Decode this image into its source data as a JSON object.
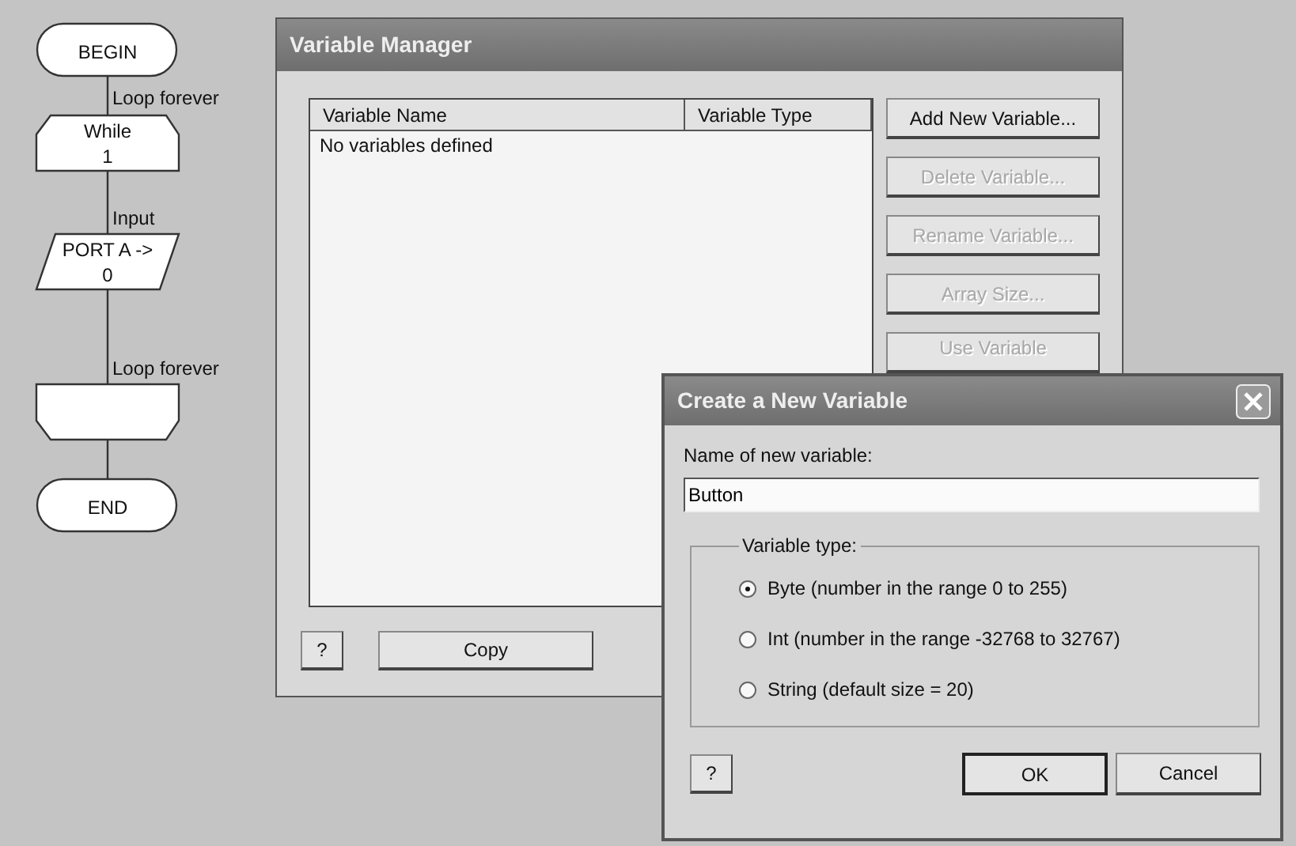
{
  "flowchart": {
    "nodes": [
      {
        "kind": "terminal",
        "text": [
          "BEGIN"
        ]
      },
      {
        "kind": "loop_start",
        "label": "Loop forever",
        "text": [
          "While",
          "1"
        ]
      },
      {
        "kind": "input",
        "label": "Input",
        "text": [
          "PORT A ->",
          "0"
        ]
      },
      {
        "kind": "loop_end",
        "label": "Loop forever"
      },
      {
        "kind": "terminal",
        "text": [
          "END"
        ]
      }
    ]
  },
  "variable_manager": {
    "title": "Variable Manager",
    "columns": [
      "Variable Name",
      "Variable Type"
    ],
    "empty_message": "No variables defined",
    "side_buttons": [
      {
        "label": "Add New Variable...",
        "disabled": false
      },
      {
        "label": "Delete Variable...",
        "disabled": true
      },
      {
        "label": "Rename Variable...",
        "disabled": true
      },
      {
        "label": "Array Size...",
        "disabled": true
      },
      {
        "label": "Use Variable",
        "disabled": true
      }
    ],
    "bottom_buttons": [
      {
        "kind": "help",
        "label": "?"
      },
      {
        "kind": "action",
        "label": "Copy"
      }
    ]
  },
  "create_dialog": {
    "title": "Create a New Variable",
    "name_label": "Name of new variable:",
    "name_value": "Button",
    "type_group": "Variable type:",
    "options": [
      {
        "label": "Byte (number in the range 0 to 255)",
        "selected": true
      },
      {
        "label": "Int (number in the range -32768 to 32767)",
        "selected": false
      },
      {
        "label": "String (default size = 20)",
        "selected": false
      }
    ],
    "buttons": [
      {
        "kind": "help",
        "label": "?",
        "default": false
      },
      {
        "kind": "action",
        "label": "OK",
        "default": true
      },
      {
        "kind": "action",
        "label": "Cancel",
        "default": false
      }
    ]
  }
}
